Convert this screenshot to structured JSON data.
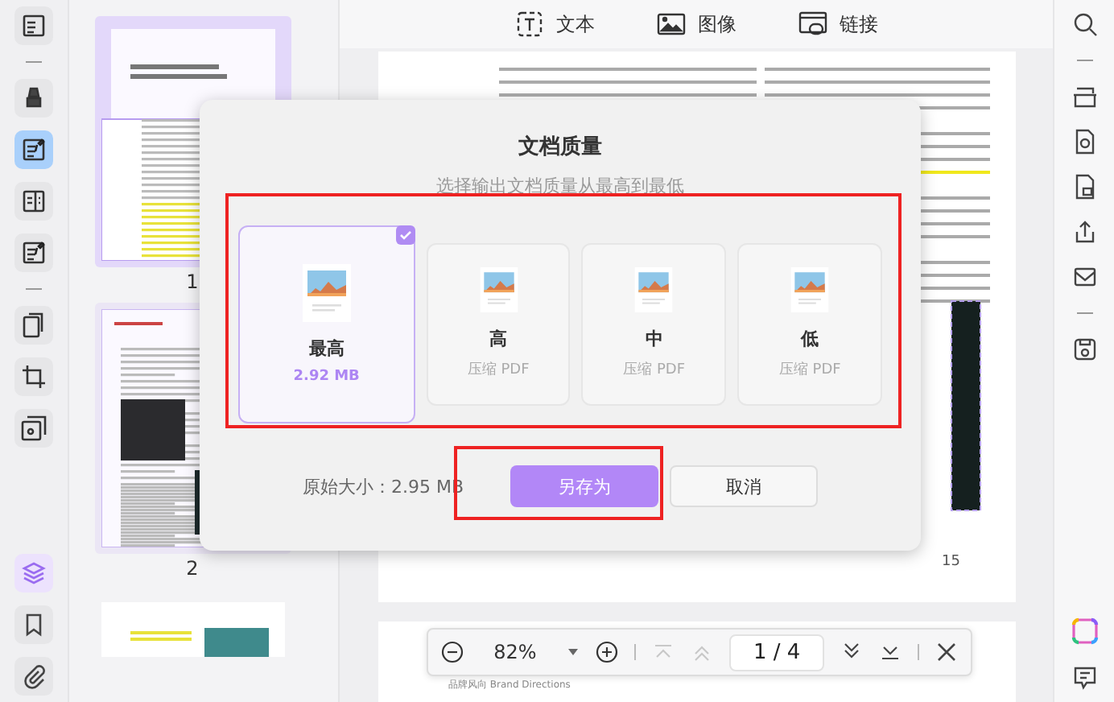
{
  "left_toolbar": {
    "tools": [
      {
        "kind": "reader",
        "selected": false
      },
      {
        "kind": "highlighter",
        "selected": false
      },
      {
        "kind": "edit",
        "selected": true
      },
      {
        "kind": "columns",
        "selected": false
      },
      {
        "kind": "form",
        "selected": false
      },
      {
        "kind": "pages",
        "selected": false
      },
      {
        "kind": "crop",
        "selected": false
      },
      {
        "kind": "watermark",
        "selected": false
      }
    ],
    "bottom_tools": [
      {
        "kind": "layers",
        "selected": true
      },
      {
        "kind": "bookmark",
        "selected": false
      },
      {
        "kind": "attachment",
        "selected": false
      }
    ]
  },
  "thumbnails": [
    {
      "label": "1",
      "selected": true
    },
    {
      "label": "2",
      "selected": false
    }
  ],
  "top_toolbar": [
    {
      "kind": "text",
      "label": "文本"
    },
    {
      "kind": "image",
      "label": "图像"
    },
    {
      "kind": "link",
      "label": "链接"
    }
  ],
  "document": {
    "page_number": "15",
    "footer_brand": "品牌风向 Brand Directions"
  },
  "zoom_bar": {
    "zoom": "82%",
    "page": "1 / 4",
    "nav": [
      {
        "kind": "first",
        "disabled": true
      },
      {
        "kind": "prev",
        "disabled": true
      },
      {
        "kind": "next",
        "disabled": false
      },
      {
        "kind": "last",
        "disabled": false
      }
    ]
  },
  "dialog": {
    "title": "文档质量",
    "subtitle": "选择输出文档质量从最高到最低",
    "options": [
      {
        "title": "最高",
        "detail": "2.92 MB",
        "selected": true
      },
      {
        "title": "高",
        "detail": "压缩 PDF",
        "selected": false
      },
      {
        "title": "中",
        "detail": "压缩 PDF",
        "selected": false
      },
      {
        "title": "低",
        "detail": "压缩 PDF",
        "selected": false
      }
    ],
    "original_size": "原始大小：2.95 MB",
    "buttons": [
      {
        "kind": "primary",
        "label": "另存为"
      },
      {
        "kind": "secondary",
        "label": "取消"
      }
    ]
  }
}
